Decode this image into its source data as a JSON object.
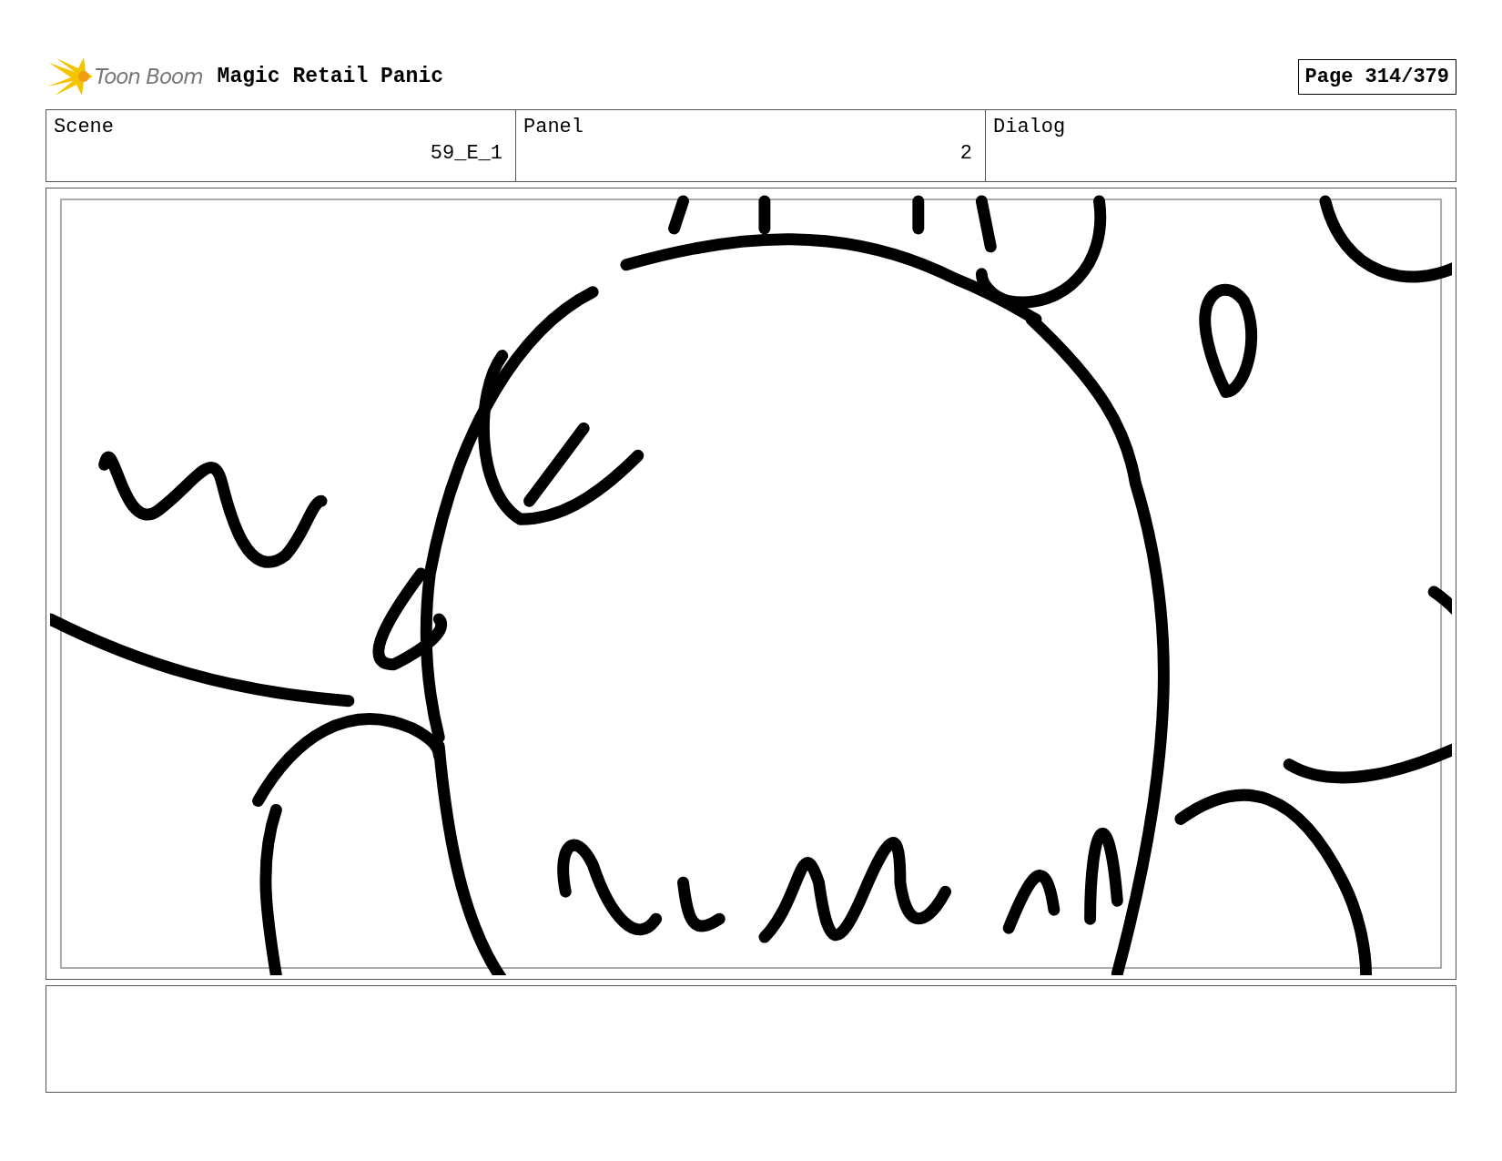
{
  "header": {
    "logo_text": "Toon Boom",
    "title": "Magic Retail Panic",
    "page": "Page 314/379"
  },
  "fields": [
    {
      "label": "Scene",
      "value": "59_E_1"
    },
    {
      "label": "Panel",
      "value": "2"
    },
    {
      "label": "Dialog"
    }
  ]
}
